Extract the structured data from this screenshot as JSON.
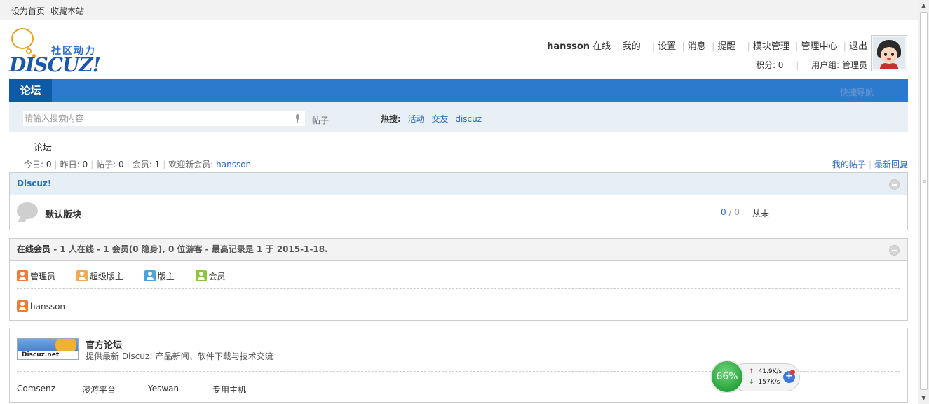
{
  "topbar": {
    "set_home": "设为首页",
    "bookmark": "收藏本站"
  },
  "logo": {
    "slogan": "社区动力",
    "wordmark": "DISCUZ!"
  },
  "user": {
    "name": "hansson",
    "status": "在线",
    "links": [
      "我的",
      "设置",
      "消息",
      "提醒",
      "模块管理",
      "管理中心",
      "退出"
    ],
    "points_label": "积分: 0",
    "group_label": "用户组: 管理员"
  },
  "nav": {
    "active_tab": "论坛",
    "quick_nav": "快捷导航"
  },
  "search": {
    "placeholder": "请输入搜索内容",
    "type": "帖子",
    "hot_label": "热搜:",
    "hot_terms": [
      "活动",
      "交友",
      "discuz"
    ]
  },
  "breadcrumb": "论坛",
  "stats": {
    "today_label": "今日:",
    "today": "0",
    "yesterday_label": "昨日:",
    "yesterday": "0",
    "posts_label": "帖子:",
    "posts": "0",
    "members_label": "会员:",
    "members": "1",
    "welcome_label": "欢迎新会员:",
    "newest": "hansson",
    "my_posts": "我的帖子",
    "latest_replies": "最新回复"
  },
  "category": {
    "title": "Discuz!",
    "forum_name": "默认版块",
    "threads": "0",
    "count_sep": "/",
    "posts": "0",
    "last_post": "从未"
  },
  "online": {
    "title": "在线会员",
    "summary": " - 1 人在线 - 1 会员(0 隐身), 0 位游客 - 最高记录是 1 于 2015-1-18.",
    "legend": [
      "管理员",
      "超级版主",
      "版主",
      "会员"
    ],
    "users": [
      "hansson"
    ]
  },
  "links": {
    "banner_text": "Discuz.net",
    "title": "官方论坛",
    "desc": "提供最新 Discuz! 产品新闻、软件下载与技术交流",
    "friends": [
      "Comsenz",
      "漫游平台",
      "Yeswan",
      "专用主机"
    ]
  },
  "speed_widget": {
    "percent": "66%",
    "up": "41.9K/s",
    "down": "157K/s",
    "plus": "+"
  },
  "colors": {
    "nav_blue": "#2b7acd",
    "nav_active": "#0e5aa6",
    "link_blue": "#2b6cc6",
    "admin_icon": "#f07a37",
    "super_mod_icon": "#f5a94f",
    "mod_icon": "#4fa3dc",
    "member_icon": "#8cc63e"
  }
}
